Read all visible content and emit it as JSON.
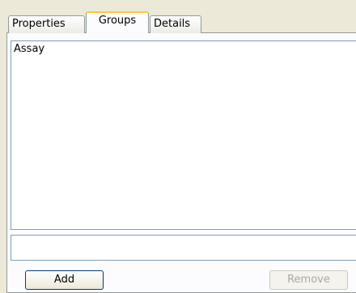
{
  "tabs": [
    {
      "label": "Properties",
      "active": false
    },
    {
      "label": "Groups",
      "active": true
    },
    {
      "label": "Details",
      "active": false
    }
  ],
  "groups_list": {
    "items": [
      "Assay"
    ]
  },
  "group_input": {
    "value": "",
    "placeholder": ""
  },
  "buttons": {
    "add_label": "Add",
    "remove_label": "Remove"
  },
  "colors": {
    "active_tab_accent": "#ffc83c",
    "window_background": "#ece9d8",
    "border": "#7f9db9",
    "disabled_text": "#aca899"
  }
}
